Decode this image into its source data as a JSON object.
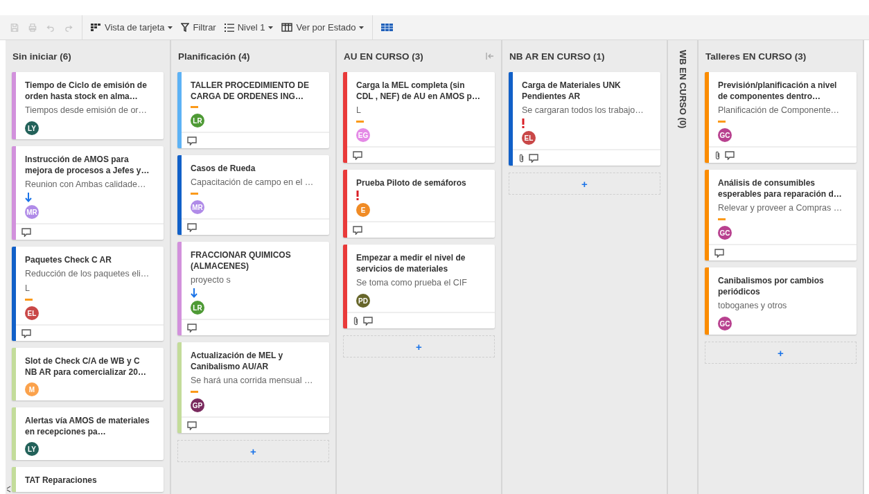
{
  "toolbar": {
    "items": [
      {
        "kind": "save",
        "disabled": true
      },
      {
        "kind": "print",
        "disabled": true
      },
      {
        "kind": "undo",
        "disabled": true
      },
      {
        "kind": "redo",
        "disabled": true
      },
      {
        "kind": "separator"
      },
      {
        "kind": "view",
        "label": "Vista de tarjeta"
      },
      {
        "kind": "filter",
        "label": "Filtrar"
      },
      {
        "kind": "level",
        "label": "Nivel 1"
      },
      {
        "kind": "group",
        "label": "Ver por Estado"
      },
      {
        "kind": "separator"
      },
      {
        "kind": "grid"
      }
    ]
  },
  "columns": [
    {
      "title": "Sin iniciar (6)",
      "collapsed": false,
      "collapse_control": false,
      "cards": [
        {
          "title": "Tiempo de Ciclo de emisión de orden hasta stock en alma…",
          "lines": [
            "Tiempos desde emisión de or…"
          ],
          "color": "#d291dc",
          "kind": "plain",
          "avatar": {
            "initials": "LY",
            "color": "#23625a"
          },
          "attachment": false,
          "comment": false
        },
        {
          "title": "Instrucción de AMOS para mejora de procesos a Jefes y…",
          "lines": [
            "Reunion con Ambas calidade…"
          ],
          "color": "#d291dc",
          "kind": "low",
          "avatar": {
            "initials": "MR",
            "color": "#b08be8"
          },
          "attachment": false,
          "comment": true
        },
        {
          "title": "Paquetes Check C AR",
          "lines": [
            "Reducción de los paquetes eli…",
            "L"
          ],
          "color": "#1160c8",
          "kind": "medium",
          "avatar": {
            "initials": "EL",
            "color": "#c94848"
          },
          "attachment": false,
          "comment": true
        },
        {
          "title": "Slot de Check C/A de WB y C NB AR para comercializar 20…",
          "color": "#c3dc9a",
          "kind": "plain",
          "avatar": {
            "initials": "M",
            "color": "#fba24c"
          },
          "attachment": false,
          "comment": false
        },
        {
          "title": "Alertas vía AMOS de materiales en recepciones pa…",
          "color": "#c3dc9a",
          "kind": "plain",
          "avatar": {
            "initials": "LY",
            "color": "#23625a"
          },
          "attachment": false,
          "comment": false
        },
        {
          "title": "TAT Reparaciones",
          "color": "#c3dc9a",
          "kind": "plain",
          "attachment": false,
          "comment": false
        }
      ]
    },
    {
      "title": "Planificación (4)",
      "collapsed": false,
      "collapse_control": false,
      "add_label": "+",
      "cards": [
        {
          "title": "TALLER PROCEDIMIENTO DE CARGA DE ORDENES ING…",
          "color": "#5db2f5",
          "kind": "medium",
          "avatar": {
            "initials": "LR",
            "color": "#4e9a35"
          },
          "attachment": false,
          "comment": true
        },
        {
          "title": "Casos de Rueda",
          "lines": [
            "Capacitación de campo en el …"
          ],
          "color": "#1160c8",
          "kind": "medium",
          "avatar": {
            "initials": "MR",
            "color": "#b08be8"
          },
          "attachment": false,
          "comment": true
        },
        {
          "title": "FRACCIONAR QUIMICOS (ALMACENES)",
          "lines": [
            "proyecto s"
          ],
          "color": "#d291dc",
          "kind": "low",
          "avatar": {
            "initials": "LR",
            "color": "#4e9a35"
          },
          "attachment": false,
          "comment": true
        },
        {
          "title": "Actualización de MEL y Canibalismo AU/AR",
          "lines": [
            "Se hará una corrida mensual …"
          ],
          "color": "#c3dc9a",
          "kind": "medium",
          "avatar": {
            "initials": "GP",
            "color": "#7a2a5e"
          },
          "attachment": false,
          "comment": true
        }
      ]
    },
    {
      "title": "AU EN CURSO (3)",
      "collapsed": false,
      "collapse_control": true,
      "add_label": "+",
      "cards": [
        {
          "title": "Carga la MEL completa (sin CDL , NEF) de AU en AMOS p…",
          "lines": [
            "L"
          ],
          "color": "#e93a3a",
          "kind": "medium",
          "avatar": {
            "initials": "EG",
            "color": "#e48ae6"
          },
          "attachment": false,
          "comment": true
        },
        {
          "title": "Prueba Piloto de semáforos",
          "color": "#e93a3a",
          "kind": "high",
          "avatar": {
            "initials": "E",
            "color": "#f08b25"
          },
          "attachment": false,
          "comment": true
        },
        {
          "title": "Empezar a medir el nivel de servicios de materiales",
          "lines": [
            "Se toma como prueba el CIF"
          ],
          "color": "#e93a3a",
          "kind": "plain",
          "avatar": {
            "initials": "PD",
            "color": "#67662a"
          },
          "attachment": true,
          "comment": true
        }
      ]
    },
    {
      "title": "NB AR EN CURSO (1)",
      "collapsed": false,
      "collapse_control": false,
      "add_label": "+",
      "cards": [
        {
          "title": "Carga de Materiales UNK Pendientes AR",
          "lines": [
            "Se cargaran todos los trabajo…"
          ],
          "color": "#1160c8",
          "kind": "high",
          "avatar": {
            "initials": "EL",
            "color": "#c94848"
          },
          "attachment": true,
          "comment": true
        }
      ]
    },
    {
      "title": "WB EN CURSO (0)",
      "collapsed": true
    },
    {
      "title": "Talleres EN CURSO (3)",
      "collapsed": false,
      "collapse_control": false,
      "add_label": "+",
      "cards": [
        {
          "title": "Previsión/planificación a nivel de componentes dentro…",
          "lines": [
            "Planificación de Componente…"
          ],
          "color": "#fb8c00",
          "kind": "medium",
          "avatar": {
            "initials": "GC",
            "color": "#b8418f"
          },
          "attachment": true,
          "comment": true
        },
        {
          "title": "Análisis de consumibles esperables para reparación d…",
          "lines": [
            "Relevar y proveer a Compras …"
          ],
          "color": "#fb8c00",
          "kind": "medium",
          "avatar": {
            "initials": "GC",
            "color": "#b8418f"
          },
          "attachment": false,
          "comment": true
        },
        {
          "title": "Canibalismos por cambios periódicos",
          "lines": [
            "toboganes y otros"
          ],
          "color": "#fb8c00",
          "kind": "plain",
          "avatar": {
            "initials": "GC",
            "color": "#b8418f"
          },
          "attachment": false,
          "comment": false
        }
      ]
    }
  ]
}
